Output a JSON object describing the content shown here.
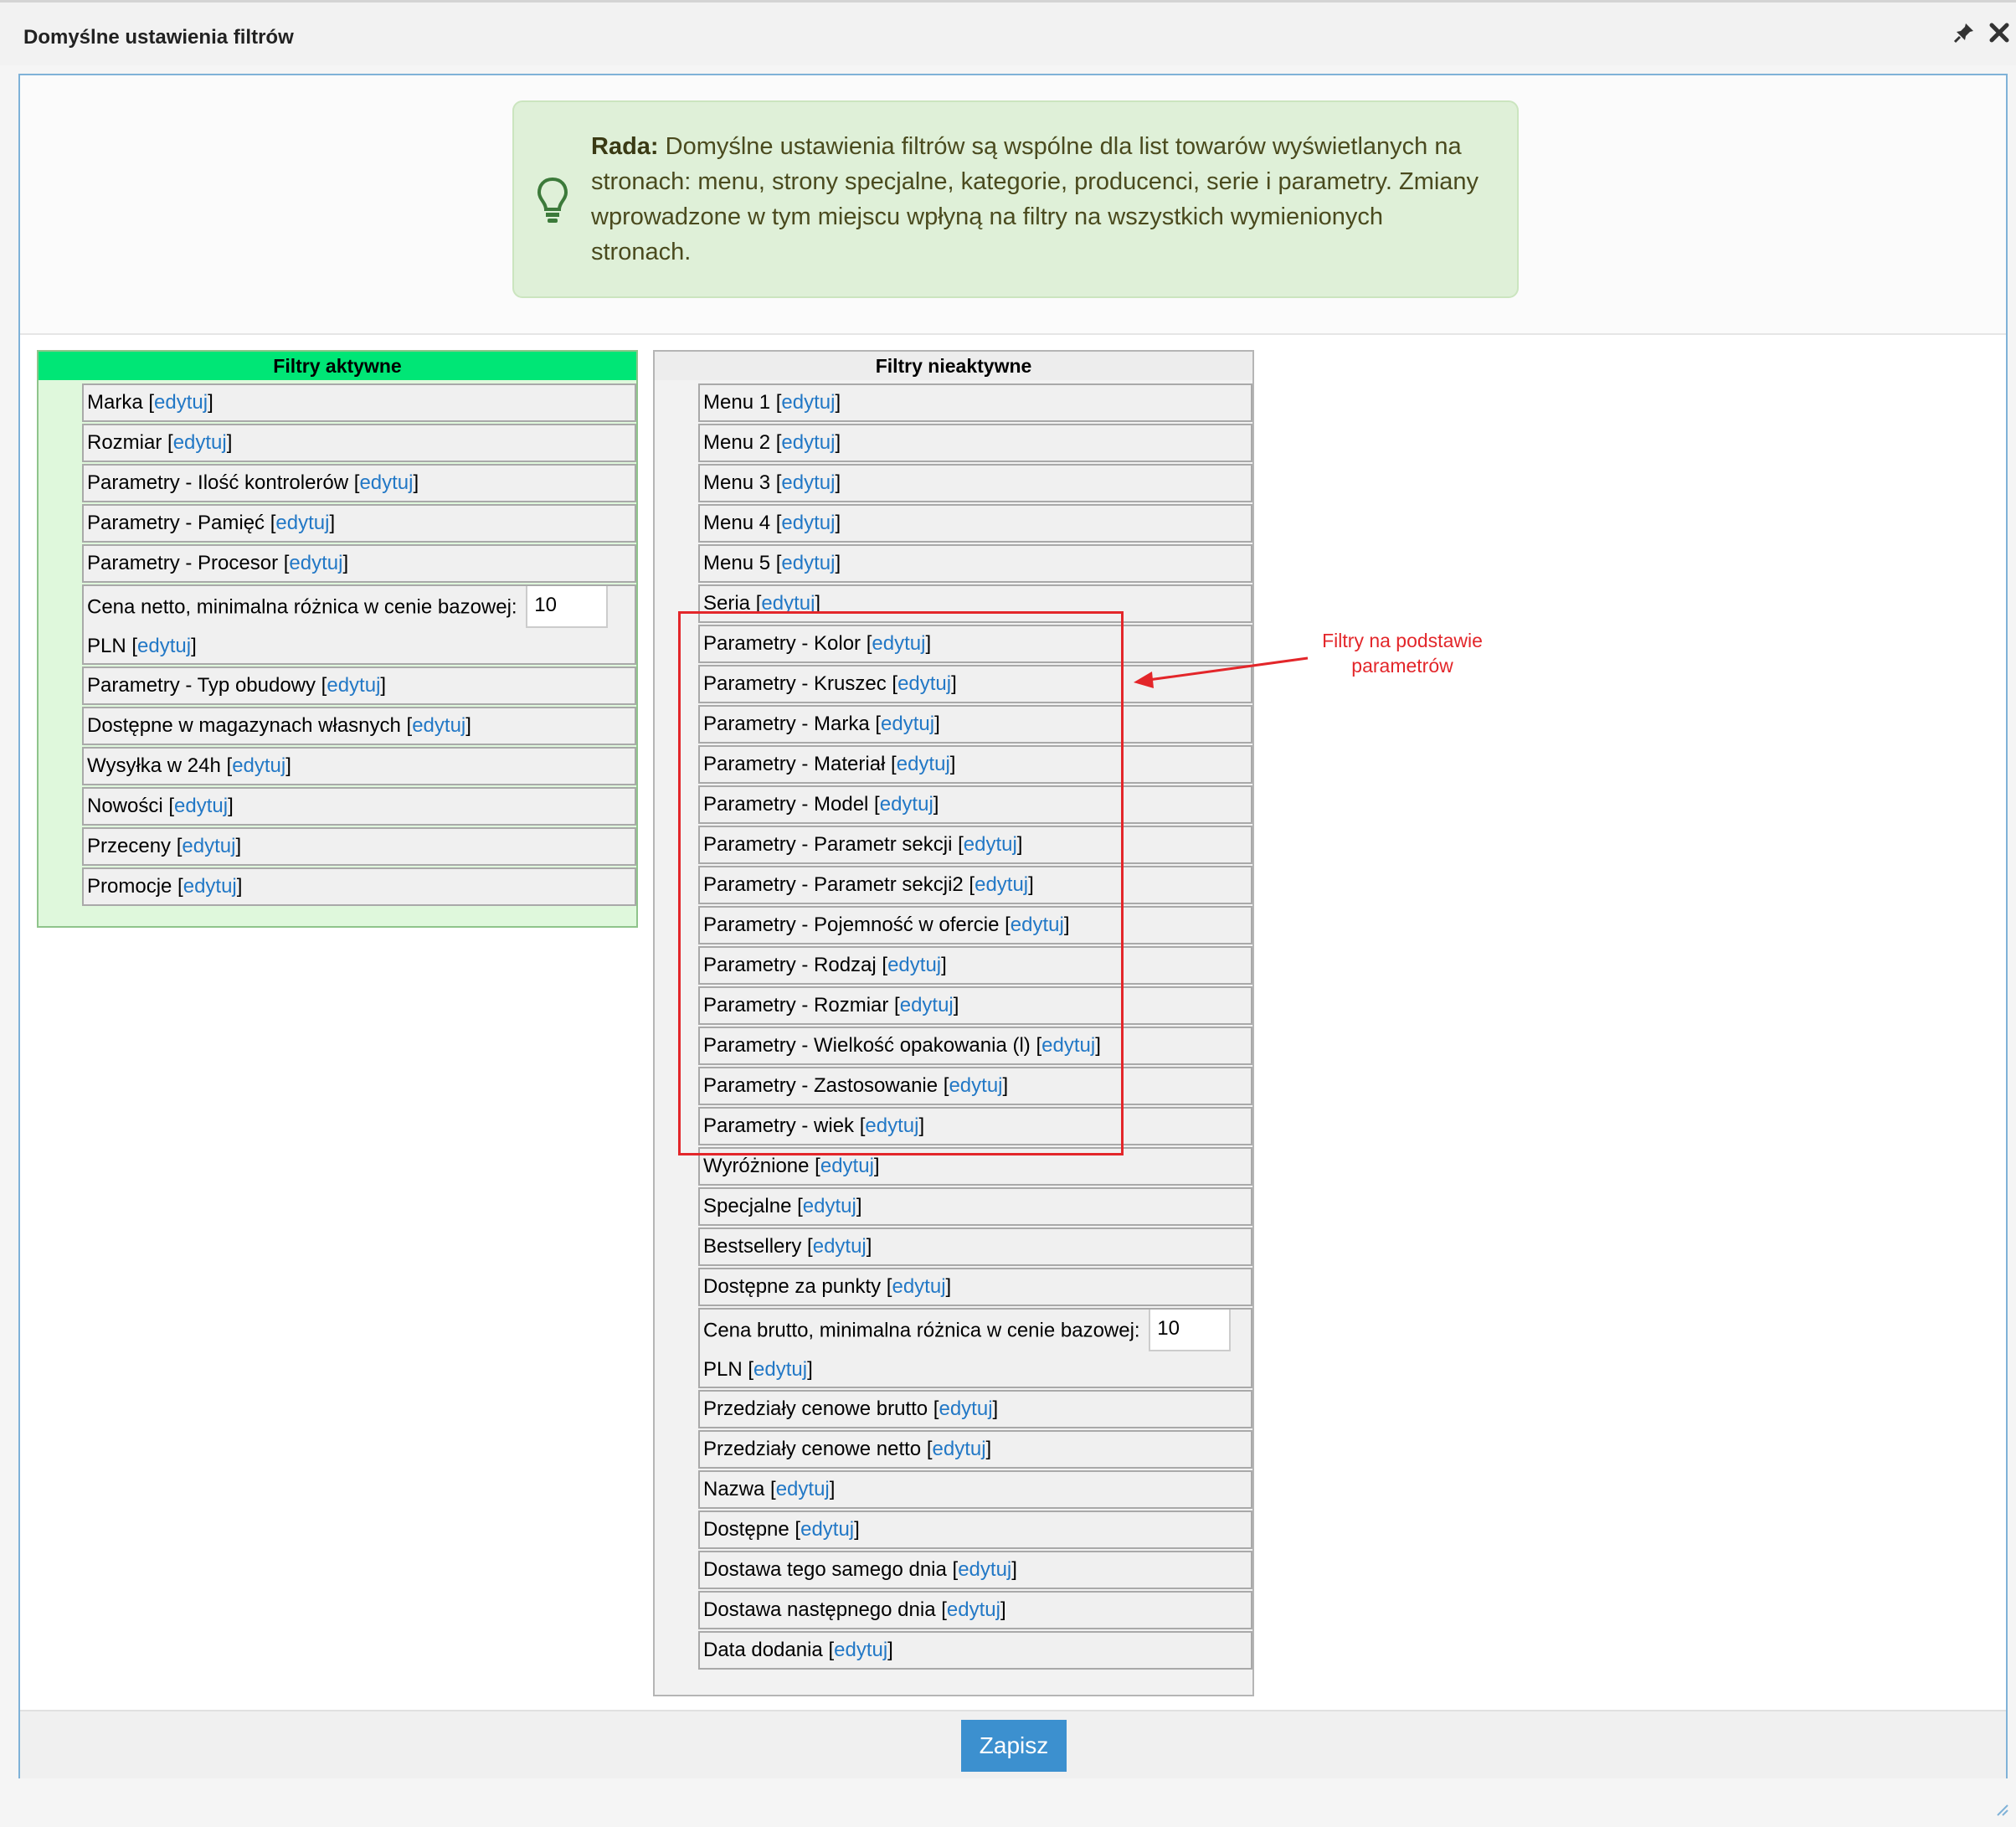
{
  "dialog": {
    "title": "Domyślne ustawienia filtrów"
  },
  "tip": {
    "label": "Rada:",
    "text": " Domyślne ustawienia filtrów są wspólne dla list towarów wyświetlanych na stronach: menu, strony specjalne, kategorie, producenci, serie i parametry. Zmiany wprowadzone w tym miejscu wpłyną na filtry na wszystkich wymienionych stronach."
  },
  "edit_label": "edytuj",
  "active": {
    "title": "Filtry aktywne",
    "items": [
      "Marka",
      "Rozmiar",
      "Parametry - Ilość kontrolerów",
      "Parametry - Pamięć",
      "Parametry - Procesor",
      "Cena netto, minimalna różnica w cenie bazowej:",
      "Parametry - Typ obudowy",
      "Dostępne w magazynach własnych",
      "Wysyłka w 24h",
      "Nowości",
      "Przeceny",
      "Promocje"
    ],
    "price_value": "10",
    "price_unit": "PLN"
  },
  "inactive": {
    "title": "Filtry nieaktywne",
    "items": [
      "Menu 1",
      "Menu 2",
      "Menu 3",
      "Menu 4",
      "Menu 5",
      "Seria",
      "Parametry - Kolor",
      "Parametry - Kruszec",
      "Parametry - Marka",
      "Parametry - Materiał",
      "Parametry - Model",
      "Parametry - Parametr sekcji",
      "Parametry - Parametr sekcji2",
      "Parametry - Pojemność w ofercie",
      "Parametry - Rodzaj",
      "Parametry - Rozmiar",
      "Parametry - Wielkość opakowania (l)",
      "Parametry - Zastosowanie",
      "Parametry - wiek",
      "Wyróżnione",
      "Specjalne",
      "Bestsellery",
      "Dostępne za punkty",
      "Cena brutto, minimalna różnica w cenie bazowej:",
      "Przedziały cenowe brutto",
      "Przedziały cenowe netto",
      "Nazwa",
      "Dostępne",
      "Dostawa tego samego dnia",
      "Dostawa następnego dnia",
      "Data dodania"
    ],
    "price_value": "10",
    "price_unit": "PLN"
  },
  "annotation": {
    "text": "Filtry na podstawie parametrów",
    "color": "#e3262a"
  },
  "footer": {
    "save_label": "Zapisz"
  },
  "colors": {
    "active_header": "#00e676",
    "link": "#2278c6",
    "save_button": "#3c90cf",
    "tip_bg": "#dff0d8"
  }
}
